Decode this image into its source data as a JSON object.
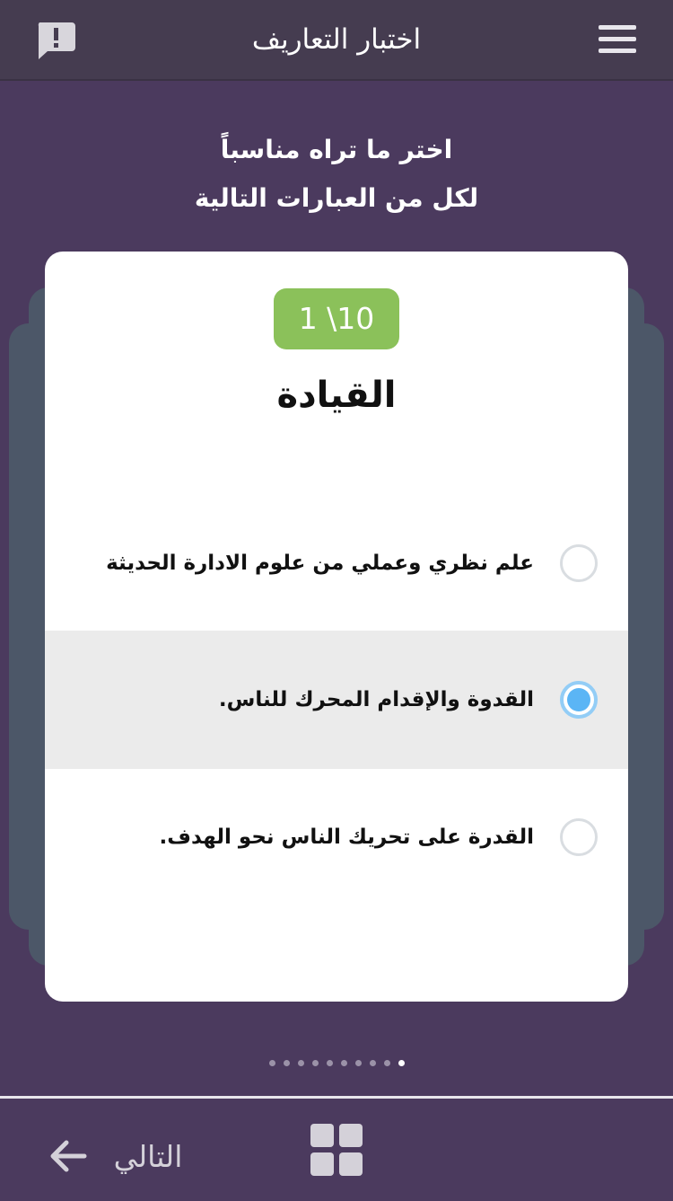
{
  "header": {
    "title": "اختبار التعاريف",
    "menu_icon": "hamburger-menu-icon",
    "report_icon": "report-exclamation-icon"
  },
  "instructions": {
    "line1": "اختر ما تراه مناسباً",
    "line2": "لكل من العبارات التالية"
  },
  "card": {
    "counter": "1 \\10",
    "question": "القيادة",
    "options": [
      {
        "label": "علم نظري وعملي من علوم الادارة الحديثة",
        "selected": false
      },
      {
        "label": "القدوة والإقدام المحرك للناس.",
        "selected": true
      },
      {
        "label": "القدرة على تحريك الناس نحو الهدف.",
        "selected": false
      }
    ]
  },
  "pagination": {
    "total": 10,
    "current": 1
  },
  "bottom_bar": {
    "next_label": "التالي",
    "grid_icon": "grid-menu-icon",
    "arrow_icon": "arrow-left-icon"
  },
  "colors": {
    "background": "#4b3a5e",
    "header": "#453c50",
    "counter_badge": "#8bc15a",
    "radio_selected": "#5bb5f5",
    "selected_row": "#ebebeb"
  }
}
